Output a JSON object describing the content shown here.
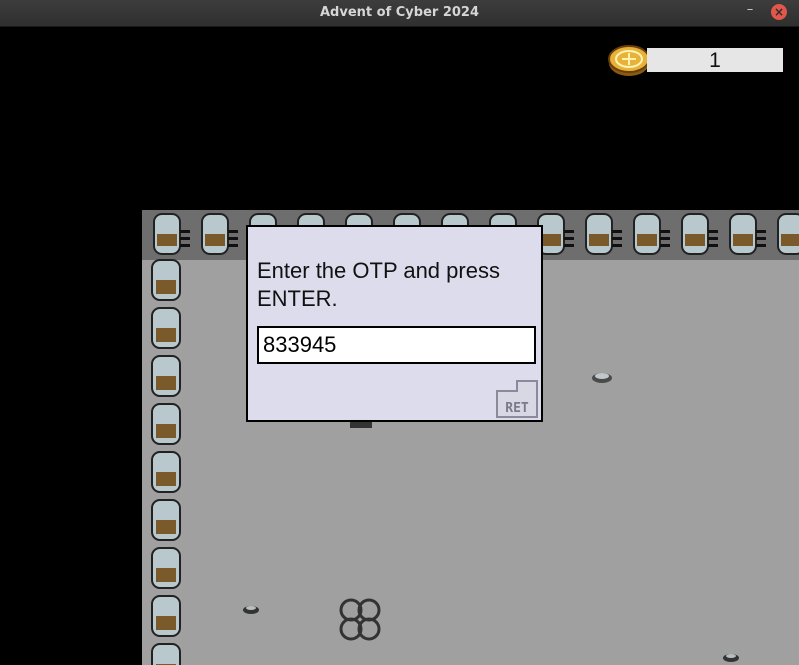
{
  "window": {
    "title": "Advent of Cyber 2024",
    "minimize_symbol": "–",
    "close_symbol": "×"
  },
  "hud": {
    "coin_count": "1",
    "coin_icon": "gold-coin-icon"
  },
  "dialog": {
    "message": "Enter the OTP and press ENTER.",
    "otp_value": "833945",
    "submit_key_label": "RET"
  },
  "colors": {
    "floor": "#a0a0a0",
    "dialog_bg": "#dcdced",
    "coin": "#e8b23a",
    "close_button": "#e2574c"
  }
}
